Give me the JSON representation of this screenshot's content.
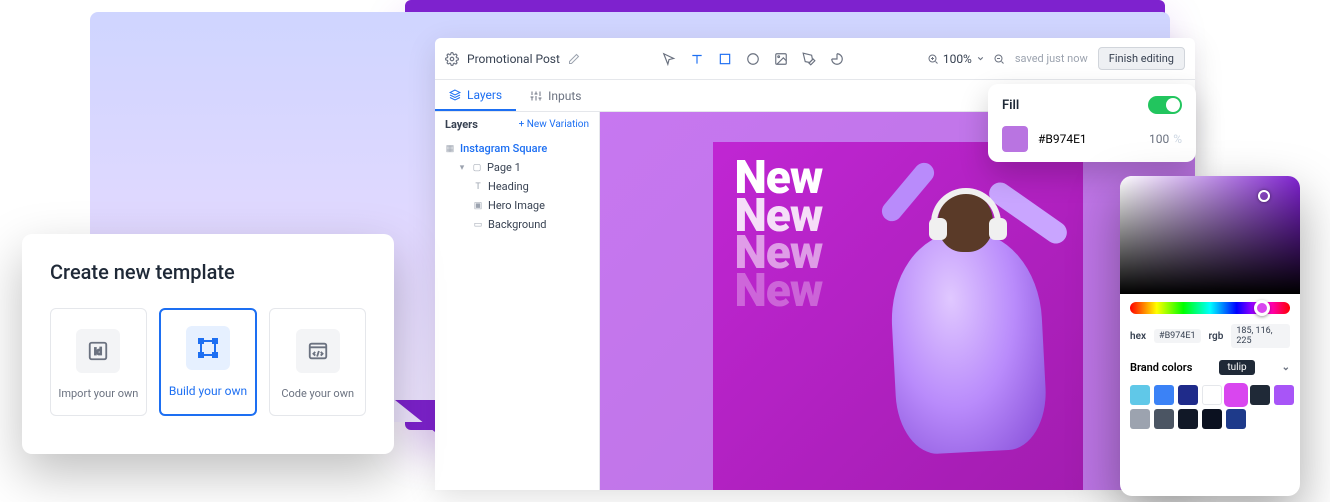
{
  "editor": {
    "title": "Promotional Post",
    "zoom_label": "100%",
    "saved_label": "saved just now",
    "finish_label": "Finish editing",
    "tabs": {
      "layers": "Layers",
      "inputs": "Inputs"
    },
    "panel": {
      "title": "Layers",
      "add": "+  New Variation",
      "tree": {
        "root": "Instagram Square",
        "page": "Page 1",
        "heading": "Heading",
        "hero": "Hero Image",
        "background": "Background"
      }
    },
    "artboard_text": "New"
  },
  "create": {
    "title": "Create new template",
    "options": {
      "import": "Import your own",
      "build": "Build your own",
      "code": "Code your own"
    }
  },
  "fill": {
    "title": "Fill",
    "hex": "#B974E1",
    "opacity": "100",
    "opacity_unit": "%"
  },
  "picker": {
    "hex_label": "hex",
    "hex_value": "#B974E1",
    "rgb_label": "rgb",
    "rgb_value": "185, 116, 225",
    "brand_label": "Brand colors",
    "brand_badge": "tulip",
    "swatches": [
      "#60c8e8",
      "#3b82f6",
      "#1f2b8a",
      "#ffffff",
      "#d946ef",
      "#1f2937",
      "#a855f7",
      "#9ca3af",
      "#4b5563",
      "#111827",
      "#0b1120",
      "#1e3a8a"
    ]
  }
}
